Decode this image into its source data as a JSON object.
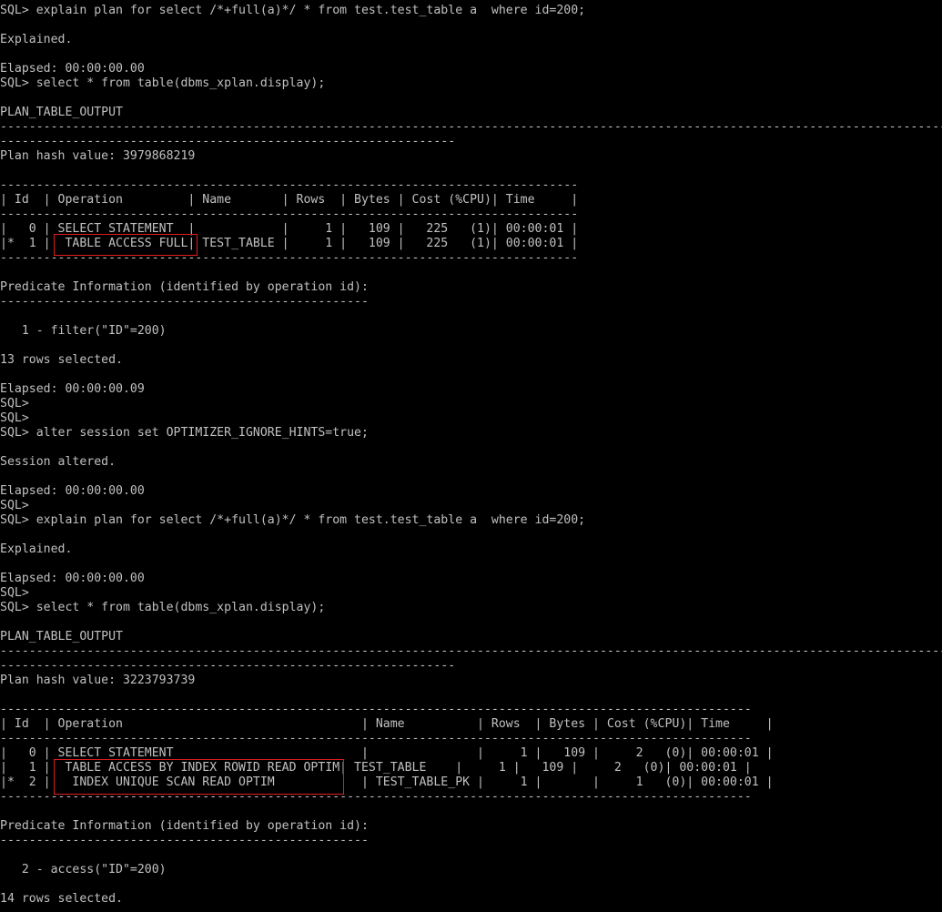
{
  "terminal": {
    "lines": [
      "SQL> explain plan for select /*+full(a)*/ * from test.test_table a  where id=200;",
      "",
      "Explained.",
      "",
      "Elapsed: 00:00:00.00",
      "SQL> select * from table(dbms_xplan.display);",
      "",
      "PLAN_TABLE_OUTPUT",
      "------------------------------------------------------------------------------------------------------------------------------------",
      "---------------------------------------------------------------",
      "Plan hash value: 3979868219",
      "",
      "--------------------------------------------------------------------------------",
      "| Id  | Operation         | Name       | Rows  | Bytes | Cost (%CPU)| Time     |",
      "--------------------------------------------------------------------------------",
      "|   0 | SELECT STATEMENT  |            |     1 |   109 |   225   (1)| 00:00:01 |",
      "|*  1 |  TABLE ACCESS FULL| TEST_TABLE |     1 |   109 |   225   (1)| 00:00:01 |",
      "--------------------------------------------------------------------------------",
      "",
      "Predicate Information (identified by operation id):",
      "---------------------------------------------------",
      "",
      "   1 - filter(\"ID\"=200)",
      "",
      "13 rows selected.",
      "",
      "Elapsed: 00:00:00.09",
      "SQL>",
      "SQL>",
      "SQL> alter session set OPTIMIZER_IGNORE_HINTS=true;",
      "",
      "Session altered.",
      "",
      "Elapsed: 00:00:00.00",
      "SQL>",
      "SQL> explain plan for select /*+full(a)*/ * from test.test_table a  where id=200;",
      "",
      "Explained.",
      "",
      "Elapsed: 00:00:00.00",
      "SQL>",
      "SQL> select * from table(dbms_xplan.display);",
      "",
      "PLAN_TABLE_OUTPUT",
      "------------------------------------------------------------------------------------------------------------------------------------",
      "---------------------------------------------------------------",
      "Plan hash value: 3223793739",
      "",
      "--------------------------------------------------------------------------------------------------------",
      "| Id  | Operation                                 | Name          | Rows  | Bytes | Cost (%CPU)| Time     |",
      "--------------------------------------------------------------------------------------------------------",
      "|   0 | SELECT STATEMENT                          |               |     1 |   109 |     2   (0)| 00:00:01 |",
      "|   1 |  TABLE ACCESS BY INDEX ROWID READ OPTIM| TEST_TABLE    |     1 |   109 |     2   (0)| 00:00:01 |",
      "|*  2 |   INDEX UNIQUE SCAN READ OPTIM            | TEST_TABLE_PK |     1 |       |     1   (0)| 00:00:01 |",
      "--------------------------------------------------------------------------------------------------------",
      "",
      "Predicate Information (identified by operation id):",
      "---------------------------------------------------",
      "",
      "   2 - access(\"ID\"=200)",
      "",
      "14 rows selected."
    ],
    "highlight_color": "#e01c1c"
  }
}
